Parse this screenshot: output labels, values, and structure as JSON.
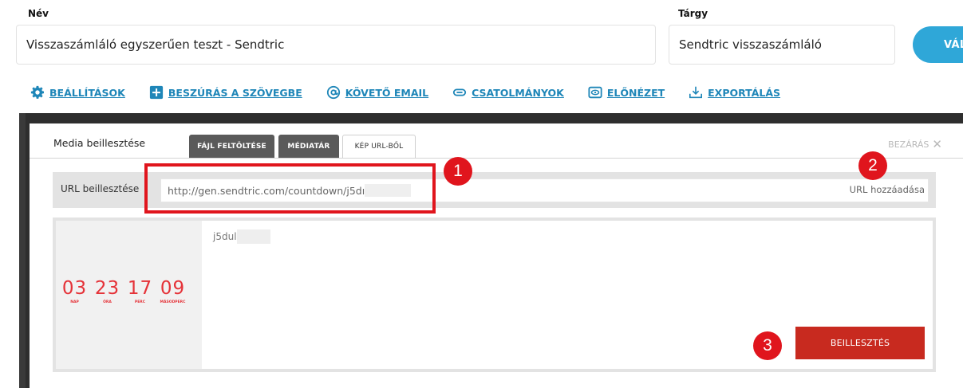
{
  "form": {
    "name_label": "Név",
    "name_value": "Visszaszámláló egyszerűen teszt - Sendtric",
    "subject_label": "Tárgy",
    "subject_value": "Sendtric visszaszámláló",
    "change_button": "VÁLTO"
  },
  "toolbar": {
    "items": [
      {
        "label": "BEÁLLÍTÁSOK",
        "icon": "gear-icon"
      },
      {
        "label": "BESZÚRÁS A SZÖVEGBE",
        "icon": "plus-square-icon"
      },
      {
        "label": "KÖVETŐ EMAIL",
        "icon": "at-icon"
      },
      {
        "label": "CSATOLMÁNYOK",
        "icon": "link-icon"
      },
      {
        "label": "ELŐNÉZET",
        "icon": "eye-icon"
      },
      {
        "label": "EXPORTÁLÁS",
        "icon": "download-icon"
      }
    ],
    "accent": "#1e86b8"
  },
  "modal": {
    "title": "Media beillesztése",
    "tabs": [
      {
        "label": "FÁJL FELTÖLTÉSE"
      },
      {
        "label": "MÉDIATÁR"
      },
      {
        "label": "KÉP URL-BŐL"
      }
    ],
    "active_tab": "KÉP URL-BŐL",
    "close_label": "BEZÁRÁS",
    "url_label": "URL beillesztése",
    "url_value": "http://gen.sendtric.com/countdown/j5dı",
    "url_add": "URL hozzáadása",
    "filename": "j5dul",
    "insert_button": "BEILLESZTÉS",
    "insert_color": "#c82a1f"
  },
  "countdown": {
    "units": [
      {
        "value": "03",
        "label": "NAP"
      },
      {
        "value": "23",
        "label": "ÓRA"
      },
      {
        "value": "17",
        "label": "PERC"
      },
      {
        "value": "09",
        "label": "MÁSODPERC"
      }
    ],
    "color": "#e53238"
  },
  "annotations": {
    "badges": [
      "1",
      "2",
      "3"
    ],
    "color": "#e0151d"
  }
}
